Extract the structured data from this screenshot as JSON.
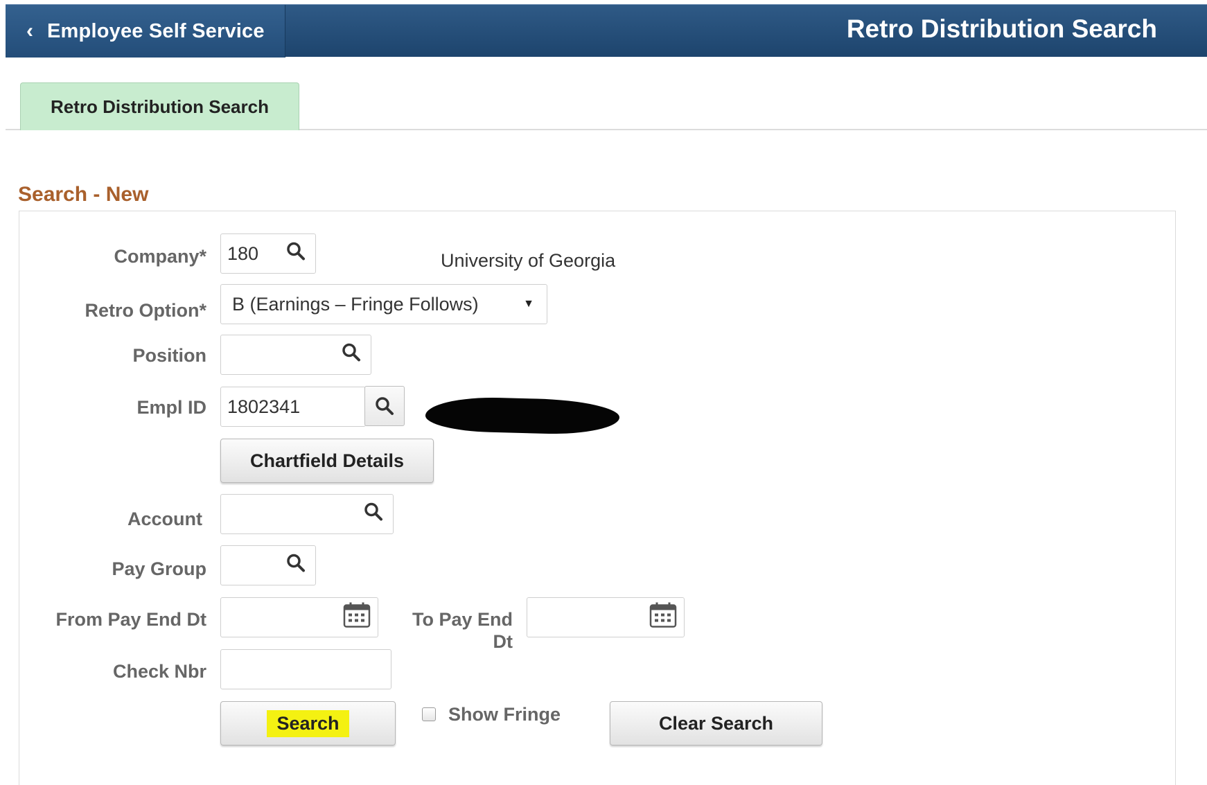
{
  "header": {
    "back_label": "Employee Self Service",
    "title": "Retro Distribution Search"
  },
  "tabs": [
    {
      "label": "Retro Distribution Search",
      "active": true
    }
  ],
  "section": {
    "title": "Search - New"
  },
  "form": {
    "company": {
      "label": "Company*",
      "value": "180",
      "description": "University of Georgia"
    },
    "retro_option": {
      "label": "Retro Option*",
      "value": "B (Earnings – Fringe Follows)"
    },
    "position": {
      "label": "Position",
      "value": ""
    },
    "empl_id": {
      "label": "Empl ID",
      "value": "1802341"
    },
    "chartfield_button": "Chartfield Details",
    "account": {
      "label": "Account",
      "value": ""
    },
    "pay_group": {
      "label": "Pay Group",
      "value": ""
    },
    "from_pay_end_dt": {
      "label": "From Pay End Dt",
      "value": ""
    },
    "to_pay_end_dt": {
      "label_line1": "To Pay End",
      "label_line2": "Dt",
      "value": ""
    },
    "check_nbr": {
      "label": "Check Nbr",
      "value": ""
    },
    "search_button": "Search",
    "show_fringe": {
      "label": "Show Fringe",
      "checked": false
    },
    "clear_search_button": "Clear Search"
  },
  "colors": {
    "banner": "#1d446d",
    "tab_active": "#c8eccf",
    "section_title": "#a9602c",
    "search_highlight": "#f4f112"
  }
}
